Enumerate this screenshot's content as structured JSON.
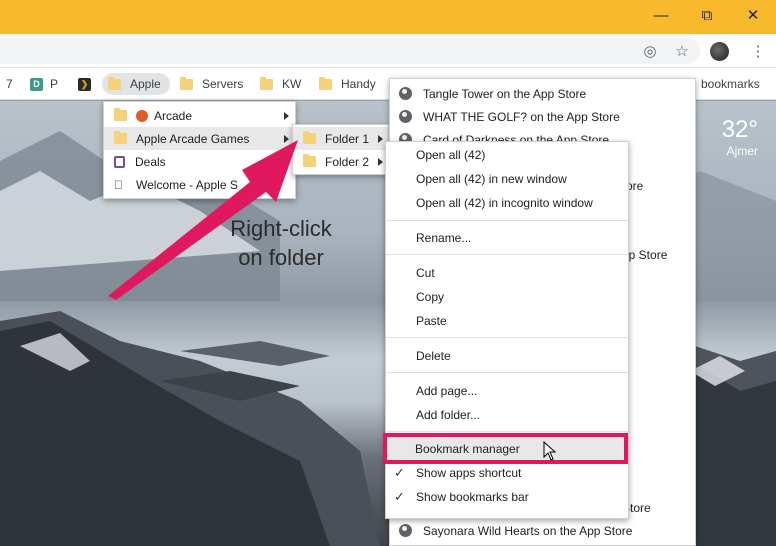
{
  "browser": {
    "window_controls": [
      "minimize",
      "maximize",
      "close"
    ],
    "toolbar_icons": [
      "location-icon",
      "star-icon",
      "avatar",
      "menu-icon"
    ]
  },
  "bookmarks_bar": {
    "items": [
      {
        "label": "7"
      },
      {
        "label": "P",
        "fav": "D"
      },
      {
        "label": "Apple"
      },
      {
        "label": "Servers"
      },
      {
        "label": "KW"
      },
      {
        "label": "Handy"
      }
    ],
    "other_bookmarks": "bookmarks"
  },
  "weather": {
    "temp": "32°",
    "city": "Ajmer"
  },
  "apple_menu": {
    "items": [
      {
        "label": "Arcade",
        "submenu": true
      },
      {
        "label": "Apple Arcade Games",
        "submenu": true
      },
      {
        "label": "Deals",
        "submenu": false
      },
      {
        "label": "Welcome - Apple S",
        "submenu": false
      }
    ]
  },
  "arcade_games_menu": {
    "items": [
      {
        "label": "Folder 1",
        "submenu": true
      },
      {
        "label": "Folder 2",
        "submenu": true
      }
    ]
  },
  "folder_list": {
    "items": [
      {
        "label": "Tangle Tower on the App Store"
      },
      {
        "label": "WHAT THE GOLF? on the App Store"
      },
      {
        "label": "Card of Darkness on the App Store"
      },
      {
        "label": "ore"
      },
      {
        "label": "pp Store"
      },
      {
        "label": "Store"
      },
      {
        "label": "Sayonara Wild Hearts on the App Store"
      }
    ]
  },
  "context_menu": {
    "open_all": "Open all (42)",
    "open_all_new_window": "Open all (42) in new window",
    "open_all_incognito": "Open all (42) in incognito window",
    "rename": "Rename...",
    "cut": "Cut",
    "copy": "Copy",
    "paste": "Paste",
    "delete": "Delete",
    "add_page": "Add page...",
    "add_folder": "Add folder...",
    "bookmark_manager": "Bookmark manager",
    "show_apps_shortcut": "Show apps shortcut",
    "show_bookmarks_bar": "Show bookmarks bar"
  },
  "annotation": {
    "line1": "Right-click",
    "line2": "on folder",
    "color": "#e0195f"
  },
  "colors": {
    "titlebar": "#f8b92c",
    "highlight": "#e0195f"
  }
}
